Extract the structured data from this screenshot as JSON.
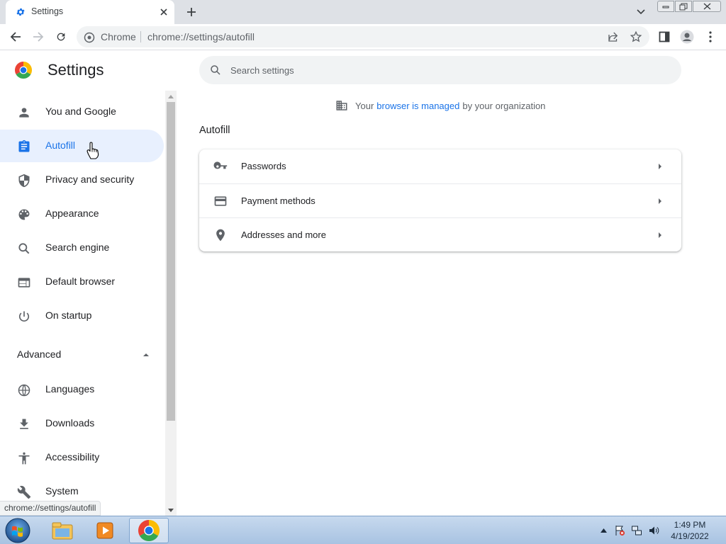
{
  "browser": {
    "tab": {
      "title": "Settings",
      "favicon": "gear-icon"
    },
    "omnibox": {
      "site_label": "Chrome",
      "url": "chrome://settings/autofill"
    },
    "status_url": "chrome://settings/autofill"
  },
  "settings": {
    "title": "Settings",
    "search_placeholder": "Search settings",
    "nav_items": [
      {
        "label": "You and Google",
        "icon": "person-icon"
      },
      {
        "label": "Autofill",
        "icon": "clipboard-icon",
        "active": true
      },
      {
        "label": "Privacy and security",
        "icon": "shield-icon"
      },
      {
        "label": "Appearance",
        "icon": "palette-icon"
      },
      {
        "label": "Search engine",
        "icon": "search-icon"
      },
      {
        "label": "Default browser",
        "icon": "browser-window-icon"
      },
      {
        "label": "On startup",
        "icon": "power-icon"
      }
    ],
    "advanced": {
      "label": "Advanced",
      "expanded": true,
      "items": [
        {
          "label": "Languages",
          "icon": "globe-icon"
        },
        {
          "label": "Downloads",
          "icon": "download-icon"
        },
        {
          "label": "Accessibility",
          "icon": "accessibility-icon"
        },
        {
          "label": "System",
          "icon": "wrench-icon"
        }
      ]
    },
    "managed_notice": {
      "prefix": "Your",
      "link": "browser is managed",
      "suffix": "by your organization"
    },
    "section": {
      "title": "Autofill",
      "rows": [
        {
          "label": "Passwords",
          "icon": "key-icon"
        },
        {
          "label": "Payment methods",
          "icon": "credit-card-icon"
        },
        {
          "label": "Addresses and more",
          "icon": "location-pin-icon"
        }
      ]
    }
  },
  "taskbar": {
    "apps": [
      "file-explorer-icon",
      "media-player-icon",
      "chrome-icon"
    ],
    "active_app": "chrome-icon",
    "clock": {
      "time": "1:49 PM",
      "date": "4/19/2022"
    }
  },
  "colors": {
    "accent": "#1a73e8",
    "active_bg": "#e8f0fe",
    "icon": "#5f6368",
    "tabstrip": "#dee1e6"
  }
}
